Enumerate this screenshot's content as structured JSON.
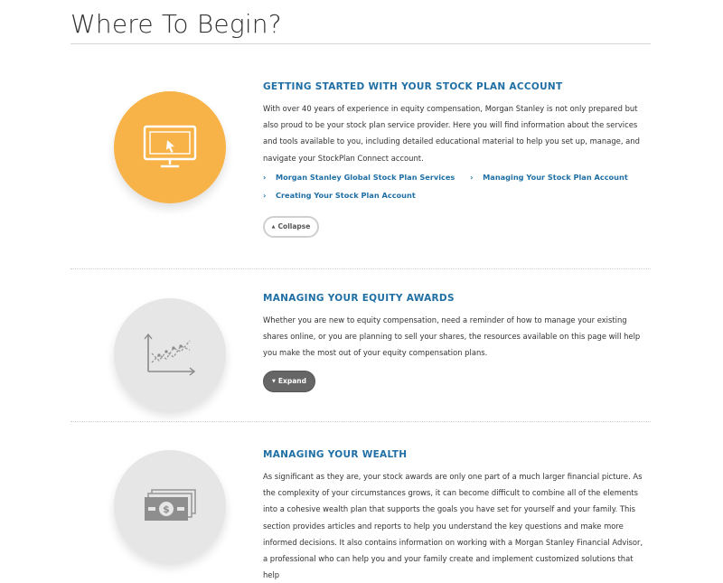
{
  "page": {
    "title": "Where To Begin?"
  },
  "sections": [
    {
      "title": "GETTING STARTED WITH YOUR STOCK PLAN ACCOUNT",
      "body": "With over 40 years of experience in equity compensation, Morgan Stanley is not only prepared but also proud to be your stock plan service provider. Here you will find information about the services and tools available to you, including detailed educational material to help you set up, manage, and navigate your StockPlan Connect account.",
      "icon": "computer-monitor-icon",
      "links": [
        {
          "label": "Morgan Stanley Global Stock Plan Services"
        },
        {
          "label": "Managing Your Stock Plan Account"
        },
        {
          "label": "Creating Your Stock Plan Account"
        }
      ],
      "button": "Collapse"
    },
    {
      "title": "MANAGING YOUR EQUITY AWARDS",
      "body": "Whether you are new to equity compensation, need a reminder of how to manage your existing shares online, or you are planning to sell your shares, the resources available on this page will help you make the most out of your equity compensation plans.",
      "icon": "line-chart-icon",
      "button": "Expand"
    },
    {
      "title": "MANAGING YOUR WEALTH",
      "body": "As significant as they are, your stock awards are only one part of a much larger financial picture. As the complexity of your circumstances grows, it can become difficult to combine all of the elements into a cohesive wealth plan that supports the goals you have set for yourself and your family. This section provides articles and reports to help you understand the key questions and make more informed decisions. It also contains information on working with a Morgan Stanley Financial Advisor, a professional who can help you and your family create and implement customized solutions that help",
      "icon": "money-stack-icon"
    }
  ],
  "colors": {
    "accent": "#1f6fa5",
    "orange": "#f8b348",
    "grey_circle": "#e6e6e6",
    "expand_button": "#666666"
  }
}
